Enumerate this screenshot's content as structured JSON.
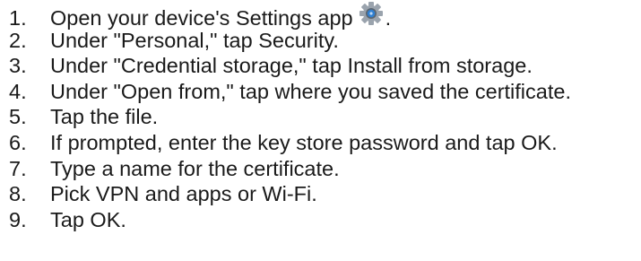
{
  "steps": [
    {
      "number": "1.",
      "text": "Open your device's Settings app",
      "suffix": ".",
      "icon": "settings-gear-icon"
    },
    {
      "number": "2.",
      "text": "Under \"Personal,\" tap Security."
    },
    {
      "number": "3.",
      "text": "Under \"Credential storage,\" tap Install from storage."
    },
    {
      "number": "4.",
      "text": "Under \"Open from,\" tap where you saved the certificate."
    },
    {
      "number": "5.",
      "text": "Tap the file."
    },
    {
      "number": "6.",
      "text": "If prompted, enter the key store password and tap OK."
    },
    {
      "number": "7.",
      "text": "Type a name for the certificate."
    },
    {
      "number": "8.",
      "text": "Pick VPN and apps or Wi-Fi."
    },
    {
      "number": "9.",
      "text": "Tap OK."
    }
  ],
  "colors": {
    "text": "#1a1a1a",
    "gear_outer": "#9aa3ad",
    "gear_inner": "#2f7fd1"
  }
}
